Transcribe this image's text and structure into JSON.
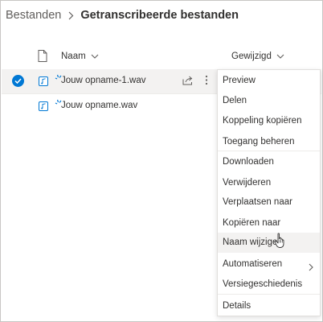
{
  "breadcrumb": {
    "root": "Bestanden",
    "current": "Getranscribeerde bestanden"
  },
  "columns": {
    "name": "Naam",
    "modified": "Gewijzigd"
  },
  "files": [
    {
      "name": "Jouw opname-1.wav",
      "selected": true,
      "icon": "audio-file-icon"
    },
    {
      "name": "Jouw opname.wav",
      "selected": false,
      "icon": "audio-file-icon"
    }
  ],
  "context_menu": {
    "items": [
      "Preview",
      "Delen",
      "Koppeling kopiëren",
      "Toegang beheren",
      "Downloaden",
      "Verwijderen",
      "Verplaatsen naar",
      "Kopiëren naar",
      "Naam wijzigen",
      "Automatiseren",
      "Versiegeschiedenis",
      "Details"
    ],
    "hovered": "Naam wijzigen"
  },
  "colors": {
    "accent": "#0078d4",
    "selected_row": "#f3f2f1",
    "new_file_spark": "#0078d4"
  }
}
